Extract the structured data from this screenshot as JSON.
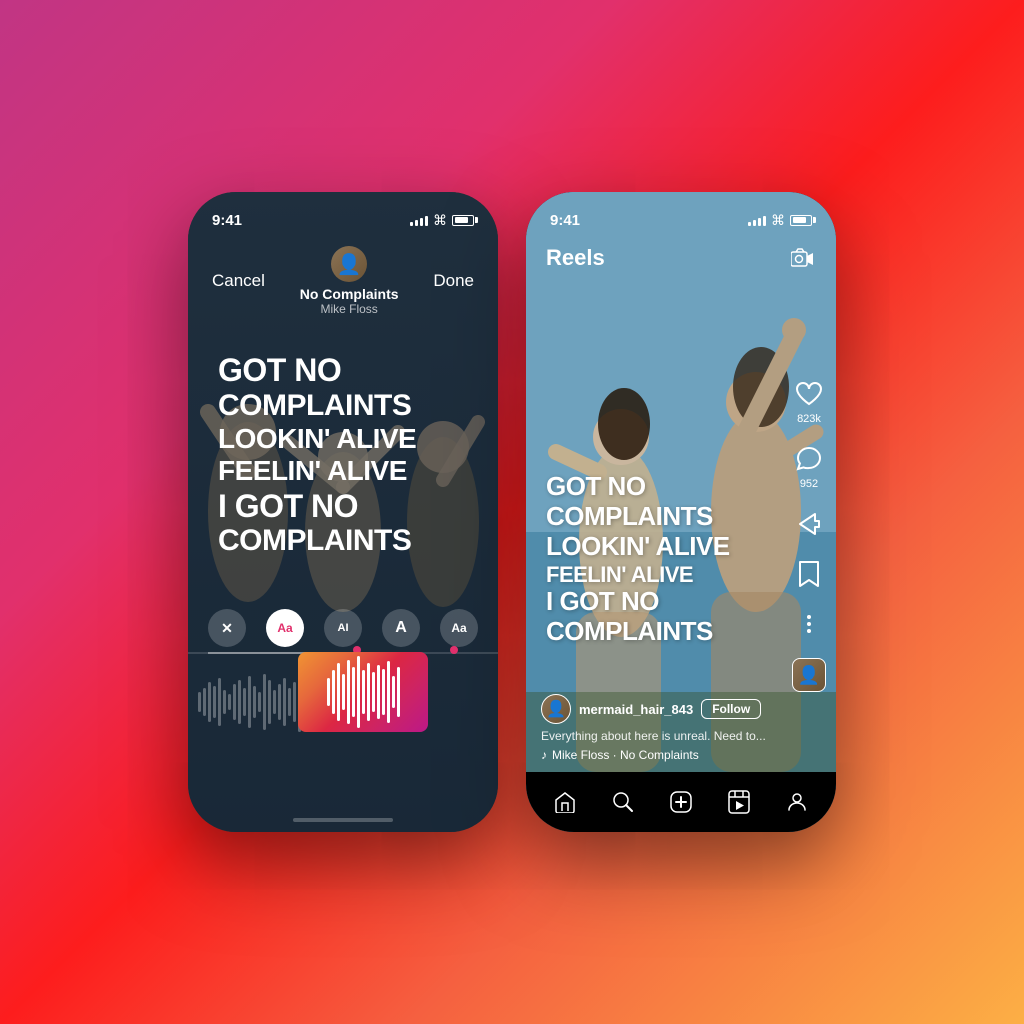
{
  "background": {
    "gradient": "linear-gradient(135deg, #c13584, #e1306c, #fd1d1d, #f56040, #fcaf45)"
  },
  "phone1": {
    "status": {
      "time": "9:41",
      "signal": [
        3,
        4,
        5,
        6
      ],
      "wifi": true,
      "battery": 80
    },
    "topbar": {
      "cancel": "Cancel",
      "done": "Done",
      "song_title": "No Complaints",
      "artist": "Mike Floss"
    },
    "lyrics": [
      "GOT NO",
      "COMPLAINTS",
      "LOOKIN' ALIVE",
      "FEELIN' ALIVE",
      "I GOT NO",
      "COMPLAINTS"
    ],
    "tools": [
      "×",
      "Aa",
      "AI",
      "A",
      "Aa"
    ]
  },
  "phone2": {
    "status": {
      "time": "9:41",
      "signal": [
        3,
        4,
        5,
        6
      ],
      "wifi": true,
      "battery": 80
    },
    "header": {
      "title": "Reels",
      "camera_icon": "📷"
    },
    "lyrics": [
      "GOT NO",
      "COMPLAINTS",
      "LOOKIN' ALIVE",
      "FEELIN' ALIVE",
      "I GOT NO",
      "COMPLAINTS"
    ],
    "actions": [
      {
        "icon": "♡",
        "count": "823k",
        "name": "like"
      },
      {
        "icon": "💬",
        "count": "952",
        "name": "comment"
      },
      {
        "icon": "✈",
        "count": "",
        "name": "share"
      },
      {
        "icon": "🔖",
        "count": "",
        "name": "save"
      },
      {
        "icon": "•••",
        "count": "",
        "name": "more"
      }
    ],
    "user": {
      "username": "mermaid_hair_843",
      "follow": "Follow",
      "caption": "Everything about here is unreal. Need to...",
      "music_note": "♪",
      "music_text": "Mike Floss · No Complaints"
    },
    "nav": [
      {
        "icon": "⌂",
        "name": "home",
        "active": true
      },
      {
        "icon": "⌕",
        "name": "search"
      },
      {
        "icon": "⊕",
        "name": "create"
      },
      {
        "icon": "▶",
        "name": "reels",
        "active": true
      },
      {
        "icon": "◯",
        "name": "profile"
      }
    ]
  }
}
